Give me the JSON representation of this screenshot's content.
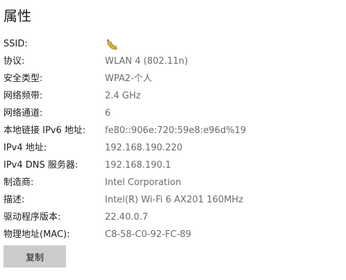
{
  "page": {
    "title": "属性"
  },
  "properties": [
    {
      "label": "SSID:",
      "value": "",
      "icon": "banana-emoji-icon"
    },
    {
      "label": "协议:",
      "value": "WLAN 4 (802.11n)"
    },
    {
      "label": "安全类型:",
      "value": "WPA2-个人"
    },
    {
      "label": "网络频带:",
      "value": "2.4 GHz"
    },
    {
      "label": "网络通道:",
      "value": "6"
    },
    {
      "label": "本地链接 IPv6 地址:",
      "value": "fe80::906e:720:59e8:e96d%19"
    },
    {
      "label": "IPv4 地址:",
      "value": "192.168.190.220"
    },
    {
      "label": "IPv4 DNS 服务器:",
      "value": "192.168.190.1"
    },
    {
      "label": "制造商:",
      "value": "Intel Corporation"
    },
    {
      "label": "描述:",
      "value": "Intel(R) Wi-Fi 6 AX201 160MHz"
    },
    {
      "label": "驱动程序版本:",
      "value": "22.40.0.7"
    },
    {
      "label": "物理地址(MAC):",
      "value": "C8-58-C0-92-FC-89"
    }
  ],
  "actions": {
    "copy_label": "复制"
  },
  "colors": {
    "label_text": "#1a1a1a",
    "value_text": "#6b6b6b",
    "button_bg": "#cccccc"
  }
}
